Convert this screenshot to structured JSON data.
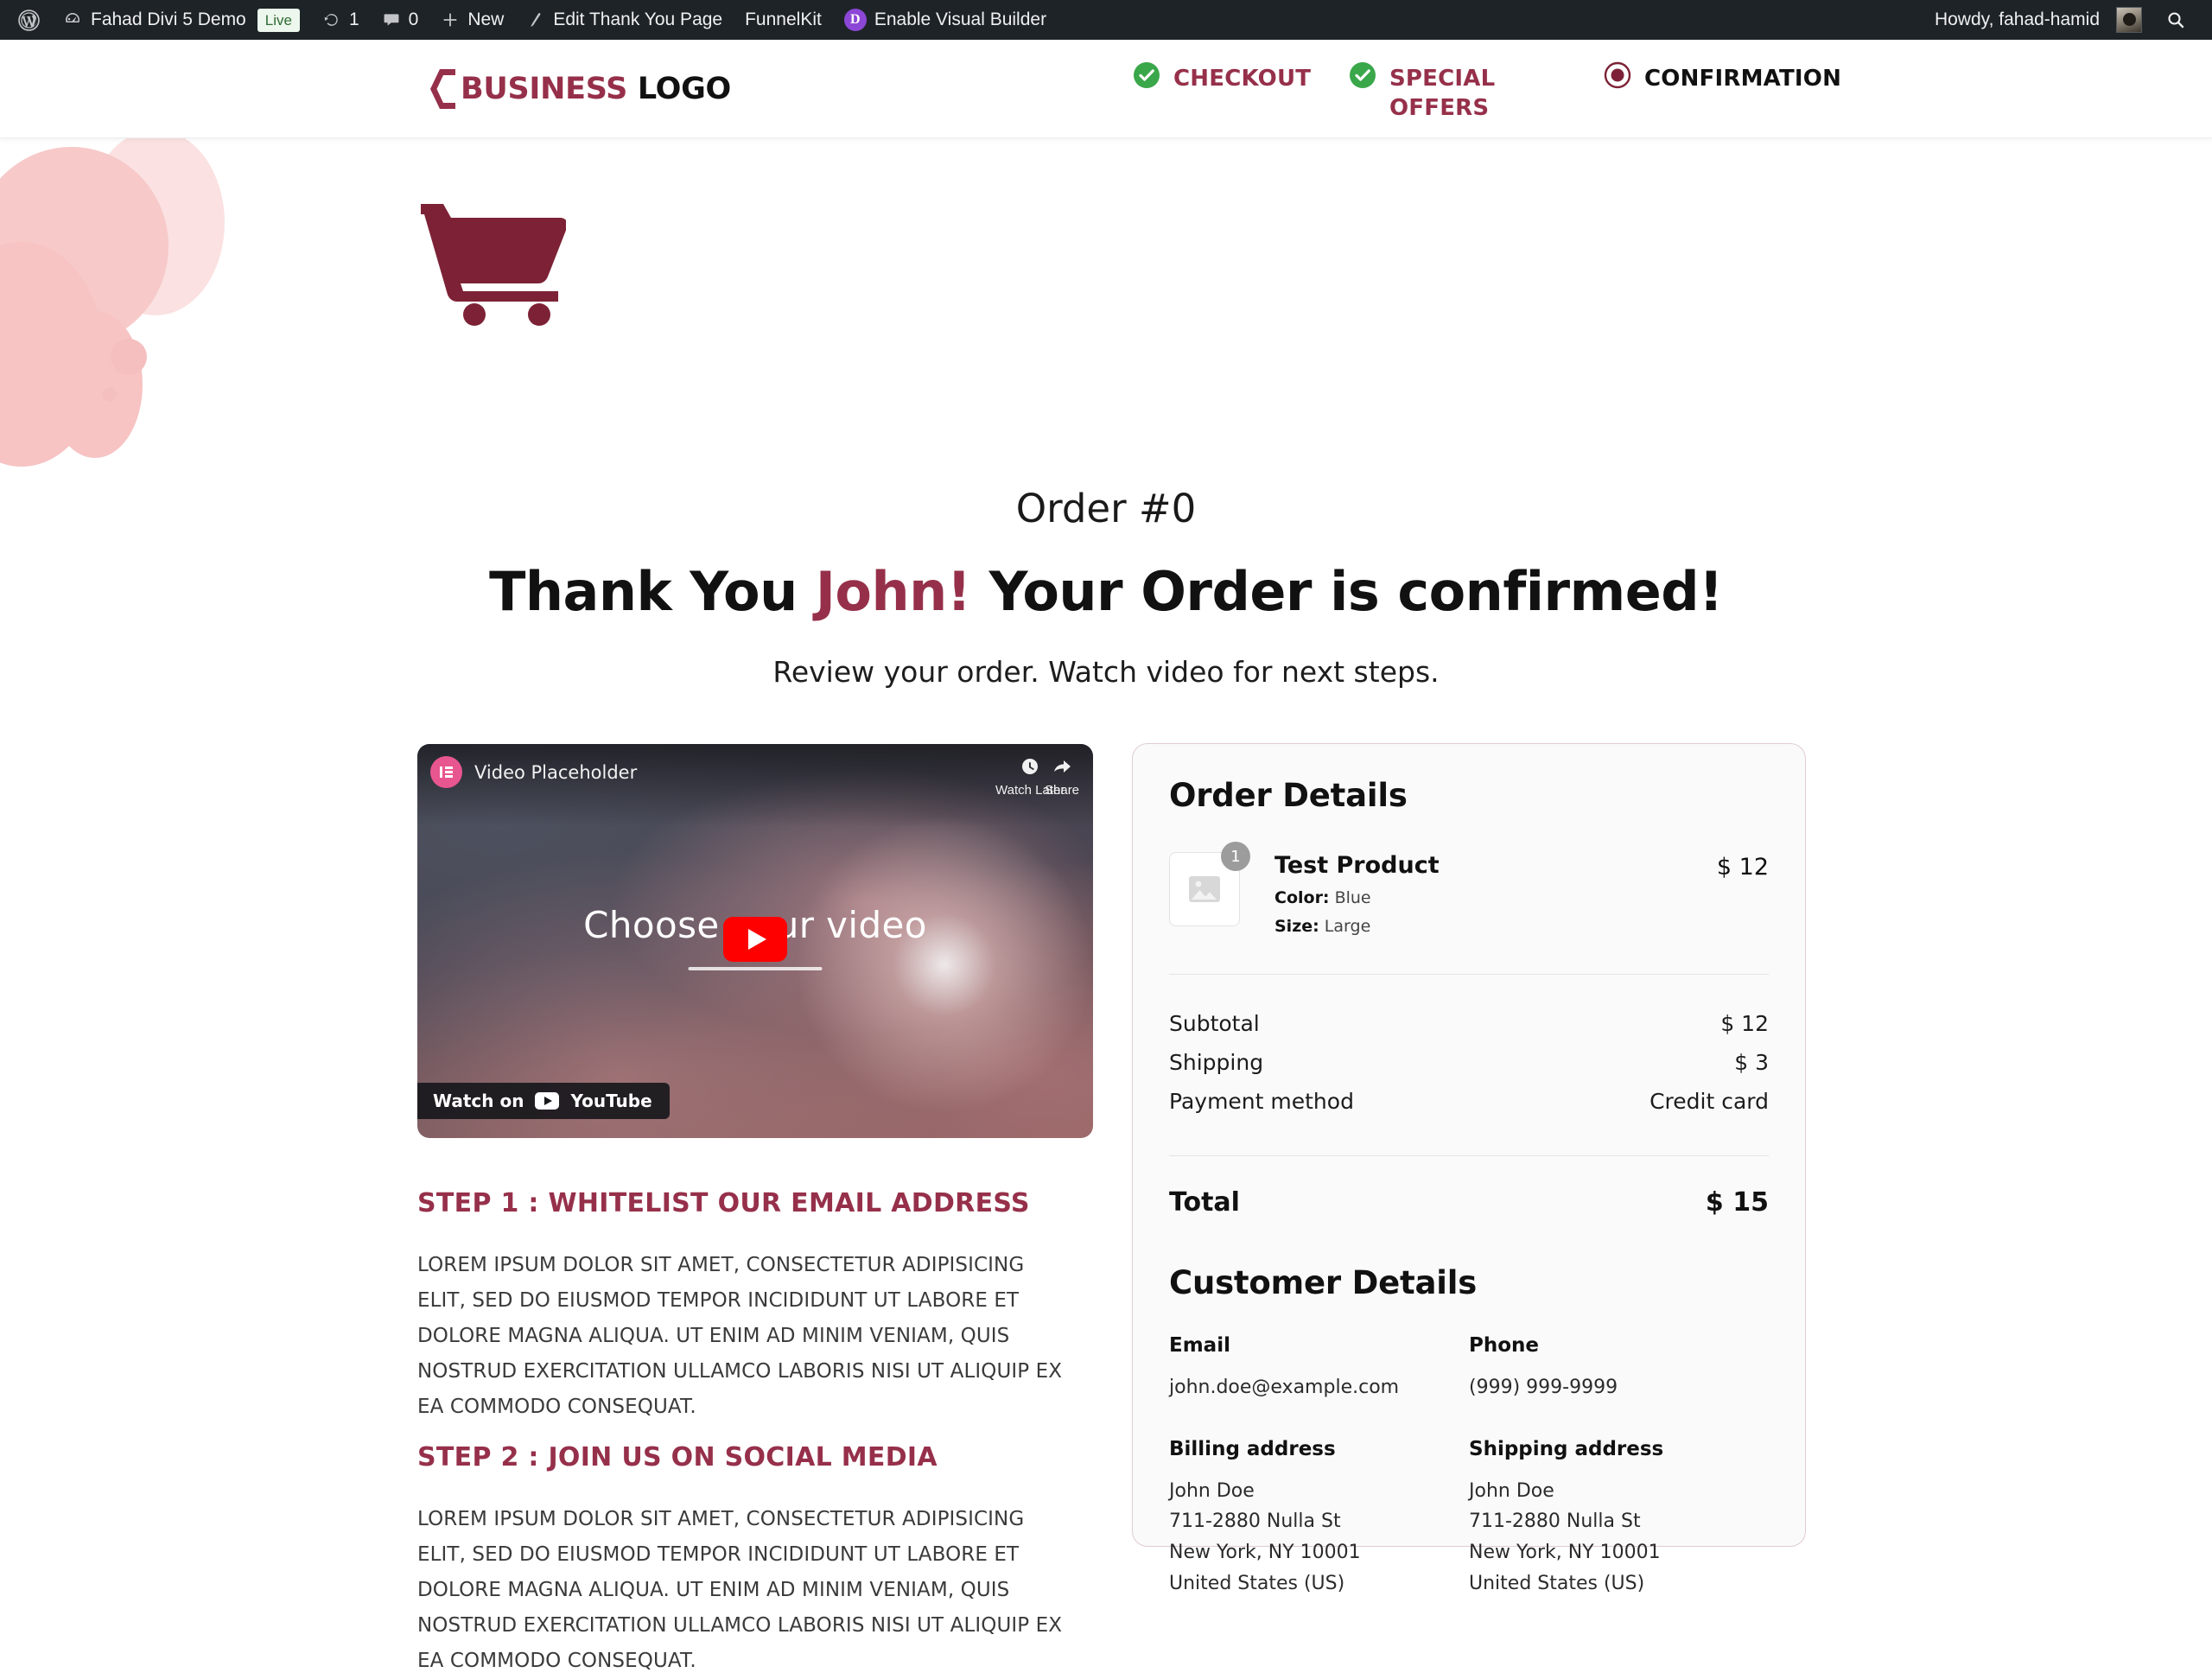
{
  "admin_bar": {
    "wp_logo_icon": "wordpress-icon",
    "items": [
      {
        "icon": "dashboard-icon",
        "label": "Fahad Divi 5 Demo",
        "badge": "Live"
      },
      {
        "icon": "update-icon",
        "label": "1"
      },
      {
        "icon": "comment-icon",
        "label": "0"
      },
      {
        "icon": "plus-icon",
        "label": "New"
      },
      {
        "icon": "pencil-icon",
        "label": "Edit Thank You Page"
      },
      {
        "icon": "",
        "label": "FunnelKit"
      },
      {
        "icon": "divi-icon",
        "label": "Enable Visual Builder"
      }
    ],
    "divi_letter": "D",
    "howdy": "Howdy, fahad-hamid",
    "search_icon": "search-icon"
  },
  "header": {
    "logo": {
      "mark_icon": "bracket-logo-icon",
      "text_primary": "BUSINESS",
      "text_secondary": "LOGO"
    },
    "steps": [
      {
        "label": "CHECKOUT",
        "state": "done",
        "icon": "check-circle-icon"
      },
      {
        "label": "SPECIAL OFFERS",
        "state": "done",
        "icon": "check-circle-icon"
      },
      {
        "label": "CONFIRMATION",
        "state": "current",
        "icon": "radio-filled-icon"
      }
    ]
  },
  "hero": {
    "cart_icon": "shopping-cart-icon",
    "order_number": "Order #0",
    "thanks_prefix": "Thank You ",
    "customer_name": "John!",
    "thanks_suffix": " Your Order is confirmed!",
    "subheading": "Review your order. Watch video for next steps."
  },
  "video": {
    "provider_icon": "elementor-icon",
    "title": "Video Placeholder",
    "watch_later": "Watch Later",
    "watch_later_icon": "clock-icon",
    "share": "Share",
    "share_icon": "share-arrow-icon",
    "center_text_before": "Choose ",
    "center_text_after": "ur video",
    "play_icon": "youtube-play-icon",
    "watch_on_prefix": "Watch on",
    "watch_on_brand": "YouTube"
  },
  "steps_content": [
    {
      "title": "STEP 1 : WHITELIST OUR EMAIL ADDRESS",
      "body": "LOREM IPSUM DOLOR SIT AMET, CONSECTETUR ADIPISICING ELIT, SED DO EIUSMOD TEMPOR INCIDIDUNT UT LABORE ET DOLORE MAGNA ALIQUA. UT ENIM AD MINIM VENIAM, QUIS NOSTRUD EXERCITATION ULLAMCO LABORIS NISI UT ALIQUIP EX EA COMMODO CONSEQUAT."
    },
    {
      "title": "STEP 2 : JOIN US ON SOCIAL MEDIA",
      "body": "LOREM IPSUM DOLOR SIT AMET, CONSECTETUR ADIPISICING ELIT, SED DO EIUSMOD TEMPOR INCIDIDUNT UT LABORE ET DOLORE MAGNA ALIQUA. UT ENIM AD MINIM VENIAM, QUIS NOSTRUD EXERCITATION ULLAMCO LABORIS NISI UT ALIQUIP EX EA COMMODO CONSEQUAT."
    }
  ],
  "order_card": {
    "heading": "Order Details",
    "product": {
      "thumb_icon": "image-placeholder-icon",
      "quantity": "1",
      "name": "Test Product",
      "attr1_label": "Color:",
      "attr1_value": "Blue",
      "attr2_label": "Size:",
      "attr2_value": "Large",
      "price": "$ 12"
    },
    "totals": [
      {
        "label": "Subtotal",
        "value": "$ 12"
      },
      {
        "label": "Shipping",
        "value": "$ 3"
      },
      {
        "label": "Payment method",
        "value": "Credit card"
      }
    ],
    "grand_label": "Total",
    "grand_value": "$ 15",
    "customer_heading": "Customer Details",
    "fields": [
      {
        "label": "Email",
        "value": "john.doe@example.com"
      },
      {
        "label": "Phone",
        "value": "(999) 999-9999"
      },
      {
        "label": "Billing address",
        "value": "John Doe\n711-2880 Nulla St\nNew York, NY 10001\nUnited States (US)"
      },
      {
        "label": "Shipping address",
        "value": "John Doe\n711-2880 Nulla St\nNew York, NY 10001\nUnited States (US)"
      }
    ]
  },
  "colors": {
    "brand_maroon": "#96304a",
    "admin_bar_bg": "#1d2327",
    "step_done_green": "#3aa74a",
    "blob_pink": "#f7c9c9",
    "card_border": "#e0ccd2",
    "youtube_red": "#ff0000",
    "elementor_pink": "#e8568f",
    "divi_purple": "#8c47d6"
  }
}
